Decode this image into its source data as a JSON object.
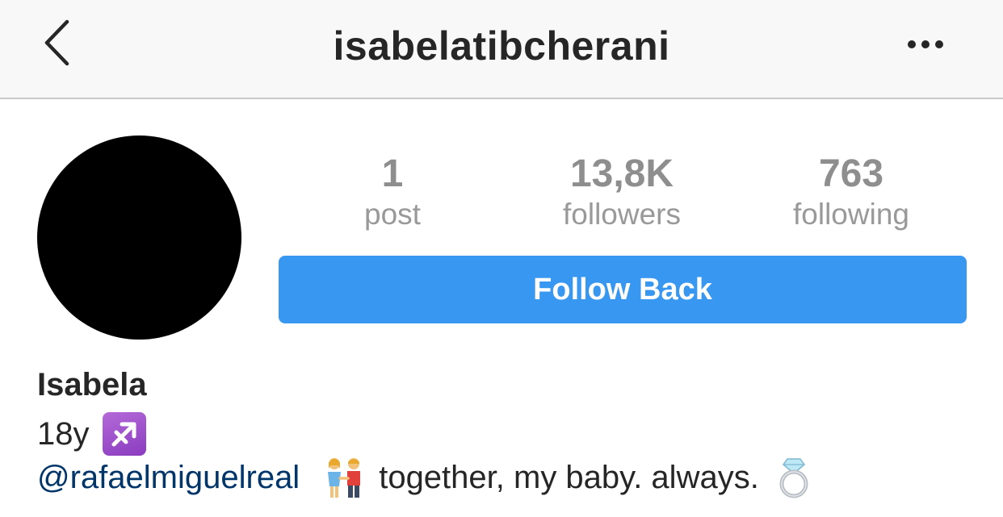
{
  "header": {
    "username": "isabelatibcherani",
    "back_icon": "chevron-left-icon",
    "more_icon": "more-horizontal-icon"
  },
  "profile": {
    "avatar_color": "#000000",
    "stats": [
      {
        "value": "1",
        "label": "post"
      },
      {
        "value": "13,8K",
        "label": "followers"
      },
      {
        "value": "763",
        "label": "following"
      }
    ],
    "follow_button_label": "Follow Back",
    "accent_color": "#3897f0"
  },
  "bio": {
    "name": "Isabela",
    "age": "18y",
    "zodiac_icon": "sagittarius-icon",
    "mention": "@rafaelmiguelreal",
    "couple_icon": "couple-holding-hands-icon",
    "text": "together, my baby. always.",
    "ring_icon": "ring-icon"
  }
}
